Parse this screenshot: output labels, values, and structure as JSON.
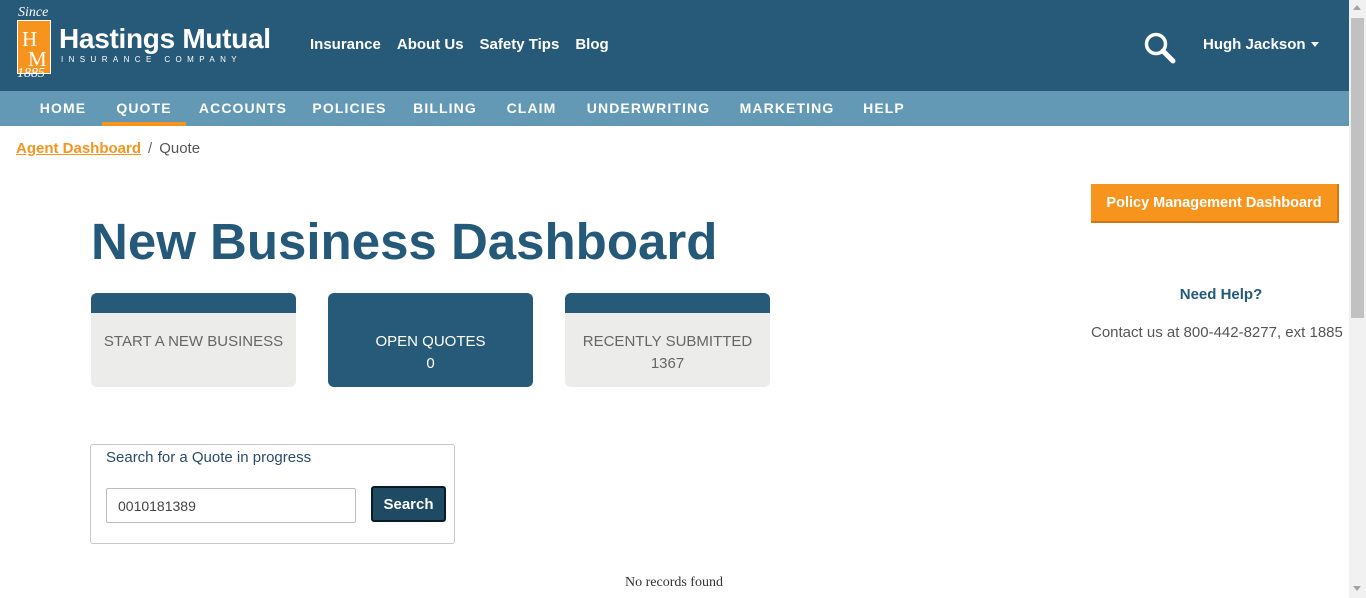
{
  "brand": {
    "name": "Hastings Mutual",
    "subtitle": "INSURANCE COMPANY",
    "since": "Since",
    "year": "1885",
    "monogram_h": "H",
    "monogram_m": "M"
  },
  "top_nav": {
    "items": [
      "Insurance",
      "About Us",
      "Safety Tips",
      "Blog"
    ]
  },
  "user": {
    "name": "Hugh Jackson"
  },
  "icons": {
    "search": "search-icon",
    "user_caret": "chevron-down-icon"
  },
  "sub_nav": {
    "items": [
      "HOME",
      "QUOTE",
      "ACCOUNTS",
      "POLICIES",
      "BILLING",
      "CLAIM",
      "UNDERWRITING",
      "MARKETING",
      "HELP"
    ],
    "active": "QUOTE"
  },
  "breadcrumb": {
    "link": "Agent Dashboard",
    "separator": "/",
    "current": "Quote"
  },
  "page": {
    "title": "New Business Dashboard"
  },
  "tiles": [
    {
      "label": "START A NEW BUSINESS",
      "count": ""
    },
    {
      "label": "OPEN QUOTES",
      "count": "0"
    },
    {
      "label": "RECENTLY SUBMITTED",
      "count": "1367"
    }
  ],
  "quote_search": {
    "legend": "Search for a Quote in progress",
    "value": "0010181389",
    "button": "Search"
  },
  "results": {
    "empty_text": "No records found"
  },
  "sidebar": {
    "pmd_button": "Policy Management Dashboard",
    "help_title": "Need Help?",
    "help_contact": "Contact us at 800-442-8277, ext 1885"
  },
  "colors": {
    "header_bg": "#275a78",
    "subnav_bg": "#6399b5",
    "accent": "#f7941d",
    "title": "#24597a"
  }
}
